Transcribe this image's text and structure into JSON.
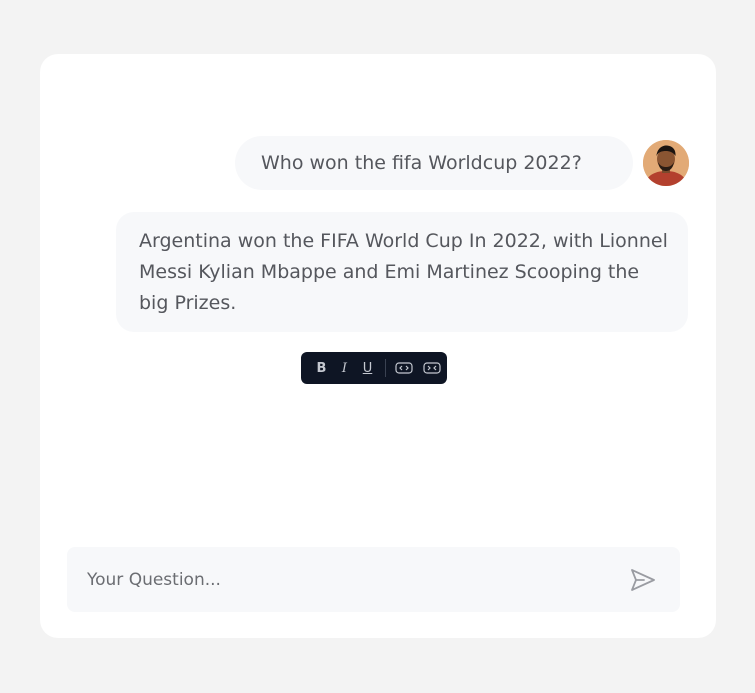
{
  "chat": {
    "user_message": "Who won the fifa Worldcup 2022?",
    "bot_message": "Argentina won the FIFA World Cup In 2022, with Lionnel Messi Kylian Mbappe and Emi Martinez Scooping the big Prizes."
  },
  "toolbar": {
    "bold": "B",
    "italic": "I",
    "underline": "U"
  },
  "input": {
    "placeholder": "Your Question...",
    "value": ""
  },
  "icons": {
    "send": "send-icon",
    "code": "code-icon",
    "collapse": "collapse-icon"
  },
  "colors": {
    "background": "#f3f3f3",
    "card": "#ffffff",
    "bubble": "#f7f8fa",
    "text": "#55575d",
    "toolbar": "#0e1524"
  }
}
